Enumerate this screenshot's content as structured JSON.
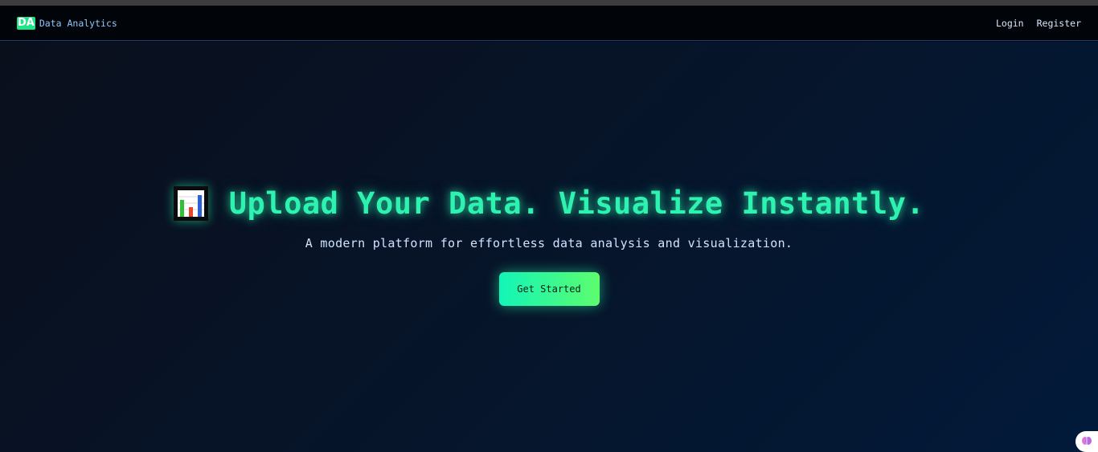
{
  "navbar": {
    "logo_text": "DA",
    "brand_name": "Data Analytics",
    "links": [
      {
        "label": "Login"
      },
      {
        "label": "Register"
      }
    ]
  },
  "hero": {
    "icon": "bar-chart-icon",
    "headline": "Upload Your Data. Visualize Instantly.",
    "subtitle": "A modern platform for effortless data analysis and visualization.",
    "cta_label": "Get Started"
  },
  "assist_widget": {
    "icon": "brain-icon"
  },
  "colors": {
    "accent": "#2ef3b0",
    "button_start": "#12f5b8",
    "button_end": "#5dfc6e",
    "nav_border": "#1f3a78"
  }
}
